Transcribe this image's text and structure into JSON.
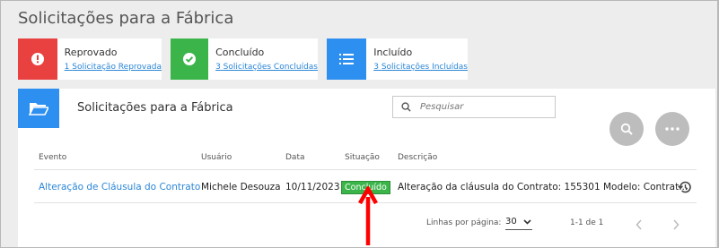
{
  "page": {
    "title": "Solicitações para a Fábrica"
  },
  "cards": [
    {
      "title": "Reprovado",
      "count": "1",
      "link": "Solicitação Reprovada",
      "icon": "alert-circle-icon",
      "color": "#e94040"
    },
    {
      "title": "Concluído",
      "count": "3",
      "link": "Solicitações Concluídas",
      "icon": "check-circle-icon",
      "color": "#3bb54a"
    },
    {
      "title": "Incluído",
      "count": "3",
      "link": "Solicitações Incluídas",
      "icon": "list-icon",
      "color": "#2d8ff0"
    }
  ],
  "panel": {
    "title": "Solicitações para a Fábrica",
    "search_placeholder": "Pesquisar"
  },
  "table": {
    "headers": [
      "Evento",
      "Usuário",
      "Data",
      "Situação",
      "Descrição"
    ],
    "rows": [
      {
        "evento": "Alteração de Cláusula do Contrato",
        "usuario": "Michele Desouza",
        "data": "10/11/2023",
        "situacao": "Concluído",
        "descricao": "Alteração da cláusula do Contrato: 155301 Modelo: Contrat..."
      }
    ]
  },
  "pagination": {
    "rows_label": "Linhas por página:",
    "rows_value": "30",
    "range": "1-1 de 1"
  },
  "colors": {
    "accent": "#2d8ff0",
    "success": "#3bb54a",
    "danger": "#e94040",
    "annotation": "#ff0000"
  }
}
